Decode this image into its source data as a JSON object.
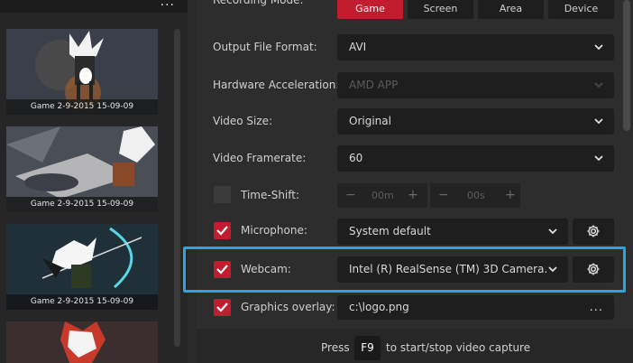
{
  "header": {
    "recording_mode_label": "Recording Mode:",
    "modes": [
      {
        "label": "Game",
        "active": true
      },
      {
        "label": "Screen",
        "active": false
      },
      {
        "label": "Area",
        "active": false
      },
      {
        "label": "Device",
        "active": false
      }
    ]
  },
  "sidebar": {
    "more_label": "...",
    "captures": [
      {
        "caption": "Game 2-9-2015 15-09-09"
      },
      {
        "caption": "Game 2-9-2015 15-09-09"
      },
      {
        "caption": "Game 2-9-2015 15-09-09"
      }
    ]
  },
  "settings": {
    "output_format": {
      "label": "Output File Format:",
      "value": "AVI"
    },
    "hw_accel": {
      "label": "Hardware Acceleration:",
      "value": "AMD APP"
    },
    "video_size": {
      "label": "Video Size:",
      "value": "Original"
    },
    "framerate": {
      "label": "Video Framerate:",
      "value": "60"
    },
    "timeshift": {
      "label": "Time-Shift:",
      "minus": "−",
      "plus": "+",
      "minutes": "00m",
      "seconds": "00s",
      "checked": false
    },
    "microphone": {
      "label": "Microphone:",
      "value": "System default",
      "checked": true
    },
    "webcam": {
      "label": "Webcam:",
      "value": "Intel (R) RealSense (TM) 3D Camera...",
      "checked": true
    },
    "overlay": {
      "label": "Graphics overlay:",
      "value": "c:\\logo.png",
      "browse": "...",
      "checked": true
    }
  },
  "footer": {
    "press": "Press",
    "key": "F9",
    "suffix": "to start/stop video capture"
  },
  "colors": {
    "accent": "#c21d2e",
    "highlight": "#27a6e4"
  }
}
